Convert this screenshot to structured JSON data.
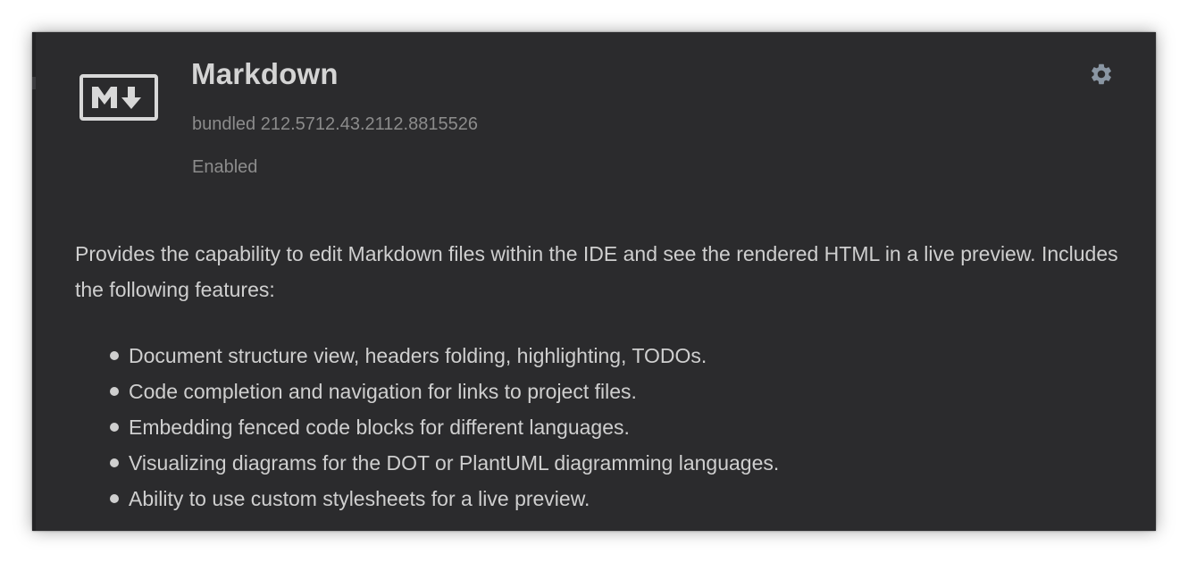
{
  "plugin": {
    "logo_icon": "markdown-logo-icon",
    "title": "Markdown",
    "version": "bundled 212.5712.43.2112.8815526",
    "status": "Enabled",
    "settings_icon": "gear-icon"
  },
  "description": {
    "text": "Provides the capability to edit Markdown files within the IDE and see the rendered HTML in a live preview. Includes the following features:",
    "features": [
      "Document structure view, headers folding, highlighting, TODOs.",
      "Code completion and navigation for links to project files.",
      "Embedding fenced code blocks for different languages.",
      "Visualizing diagrams for the DOT or PlantUML diagramming languages.",
      "Ability to use custom stylesheets for a live preview."
    ]
  },
  "colors": {
    "background": "#2b2b2d",
    "title": "#d4d4d4",
    "secondary_text": "#8c8c8c",
    "body_text": "#cfcfcf",
    "icon": "#8a96a3"
  }
}
